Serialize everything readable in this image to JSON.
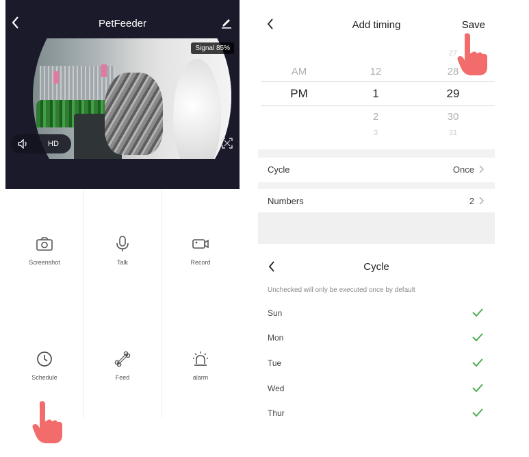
{
  "left": {
    "title": "PetFeeder",
    "signal": "Signal 85%",
    "hd": "HD",
    "actions": [
      {
        "label": "Screenshot",
        "icon": "camera-icon"
      },
      {
        "label": "Talk",
        "icon": "microphone-icon"
      },
      {
        "label": "Record",
        "icon": "video-record-icon"
      },
      {
        "label": "Schedule",
        "icon": "clock-icon"
      },
      {
        "label": "Feed",
        "icon": "bone-icon"
      },
      {
        "label": "alarm",
        "icon": "alarm-light-icon"
      }
    ]
  },
  "add_timing": {
    "title": "Add timing",
    "save": "Save",
    "picker": {
      "ampm": {
        "above": "AM",
        "selected": "PM"
      },
      "hour": {
        "above": "12",
        "selected": "1",
        "below": "2",
        "far_below": "3"
      },
      "minute": {
        "far_above": "27",
        "above": "28",
        "selected": "29",
        "below": "30",
        "far_below": "31"
      }
    },
    "rows": [
      {
        "label": "Cycle",
        "value": "Once"
      },
      {
        "label": "Numbers",
        "value": "2"
      }
    ]
  },
  "cycle": {
    "title": "Cycle",
    "hint": "Unchecked will only be executed once by default",
    "days": [
      "Sun",
      "Mon",
      "Tue",
      "Wed",
      "Thur"
    ],
    "check_color": "#4caf50"
  },
  "colors": {
    "dark_header": "#1a1a2a",
    "hand": "#f06b6b"
  }
}
